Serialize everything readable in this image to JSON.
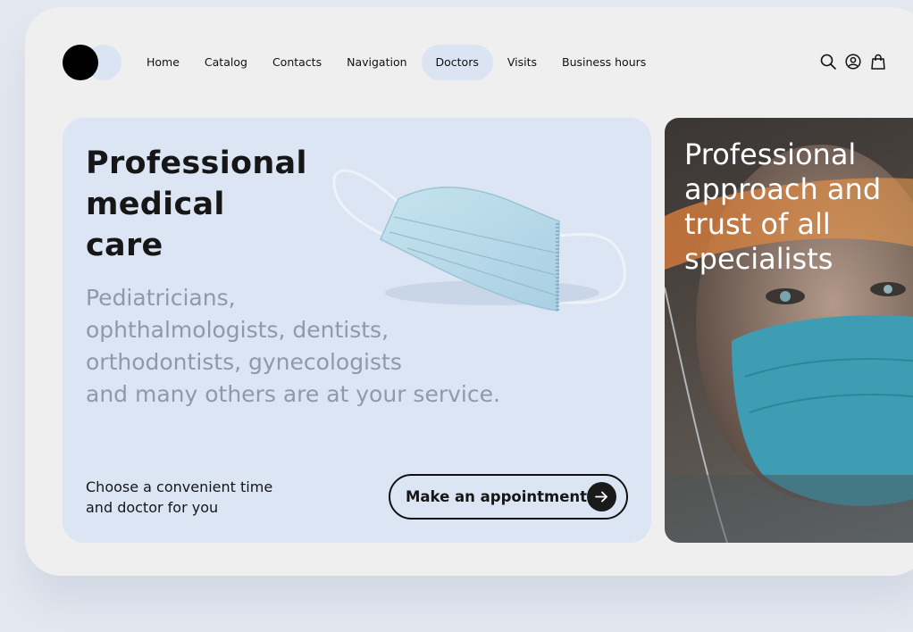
{
  "nav": {
    "items": [
      {
        "label": "Home",
        "active": false
      },
      {
        "label": "Catalog",
        "active": false
      },
      {
        "label": "Contacts",
        "active": false
      },
      {
        "label": "Navigation",
        "active": false
      },
      {
        "label": "Doctors",
        "active": true
      },
      {
        "label": "Visits",
        "active": false
      },
      {
        "label": "Business hours",
        "active": false
      }
    ],
    "icons": [
      "search-icon",
      "user-icon",
      "bag-icon"
    ]
  },
  "hero": {
    "title_lines": [
      "Professional",
      "medical",
      "care"
    ],
    "subtitle_lines": [
      "Pediatricians,",
      "ophthalmologists, dentists,",
      "orthodontists, gynecologists",
      "and many others are at your service."
    ],
    "note_lines": [
      "Choose a convenient time",
      "and doctor for you"
    ],
    "cta_label": "Make an appointment"
  },
  "side": {
    "title_lines": [
      "Professional",
      "approach and",
      "trust of all",
      "specialists"
    ]
  },
  "colors": {
    "background": "#e4e8f0",
    "card": "#efefef",
    "accent_light": "#dbe4f3",
    "dark": "#111111",
    "muted_text": "#8e9aac"
  }
}
